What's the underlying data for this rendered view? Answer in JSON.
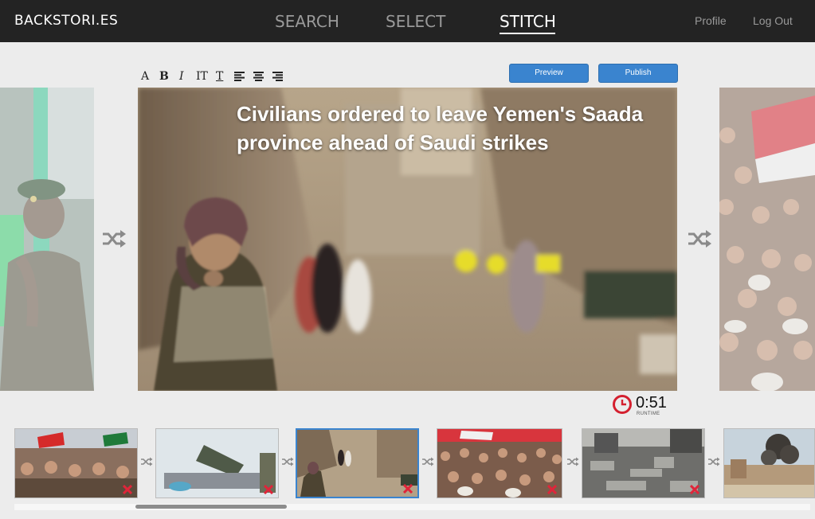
{
  "header": {
    "brand": "BACKSTORI.ES",
    "nav": [
      {
        "label": "SEARCH",
        "active": false
      },
      {
        "label": "SELECT",
        "active": false
      },
      {
        "label": "STITCH",
        "active": true
      }
    ],
    "profile_label": "Profile",
    "logout_label": "Log Out"
  },
  "toolbar": {
    "tools": [
      {
        "name": "font",
        "glyph": "A"
      },
      {
        "name": "bold",
        "glyph": "B"
      },
      {
        "name": "italic",
        "glyph": "I"
      },
      {
        "name": "text-size",
        "glyph": "IT"
      },
      {
        "name": "underline",
        "glyph": "T"
      }
    ],
    "align_tools": [
      "align-left",
      "align-center",
      "align-right"
    ],
    "preview_label": "Preview",
    "publish_label": "Publish"
  },
  "main": {
    "headline": "Civilians ordered to leave Yemen's Saada province ahead of Saudi strikes"
  },
  "runtime": {
    "value": "0:51",
    "label": "RUNTIME"
  },
  "filmstrip": {
    "items": [
      {
        "name": "protest-crowd-flags",
        "selected": false
      },
      {
        "name": "missile-display",
        "selected": false
      },
      {
        "name": "child-in-alley",
        "selected": true
      },
      {
        "name": "rally-banners",
        "selected": false
      },
      {
        "name": "rubble-ruins",
        "selected": false
      },
      {
        "name": "smoke-over-town",
        "selected": false
      }
    ]
  },
  "colors": {
    "accent": "#3a84cf",
    "nav_bg": "#232323",
    "remove": "#e0253a",
    "clock": "#d4202f"
  }
}
